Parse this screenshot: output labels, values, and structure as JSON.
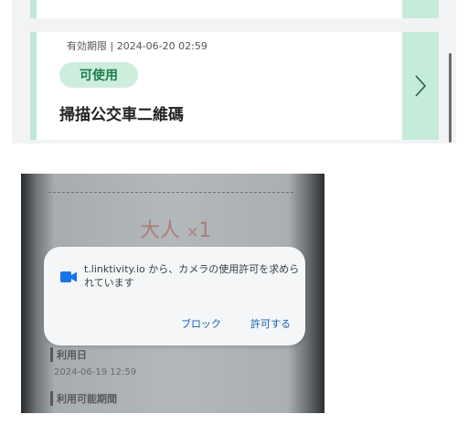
{
  "ticket": {
    "valid_until": "有効期限 | 2024-06-20 02:59",
    "status_badge": "可使用",
    "title": "掃描公交車二維碼"
  },
  "phone": {
    "fare_label": "大人",
    "fare_multiplier": "×",
    "fare_count": "1",
    "permission_message": "t.linktivity.io から、カメラの使用許可を求められています",
    "block_button": "ブロック",
    "allow_button": "許可する",
    "usage_date_label": "利用日",
    "usage_date_value": "2024-06-19 12:59",
    "usage_period_label": "利用可能期間"
  },
  "colors": {
    "accent_green": "#1d7d4e",
    "badge_bg": "#cdeedd",
    "side_button_bg": "#c5ebda",
    "dialog_button_blue": "#1a5fb4"
  },
  "icons": {
    "chevron": "chevron-right-icon",
    "camera": "camera-icon"
  }
}
